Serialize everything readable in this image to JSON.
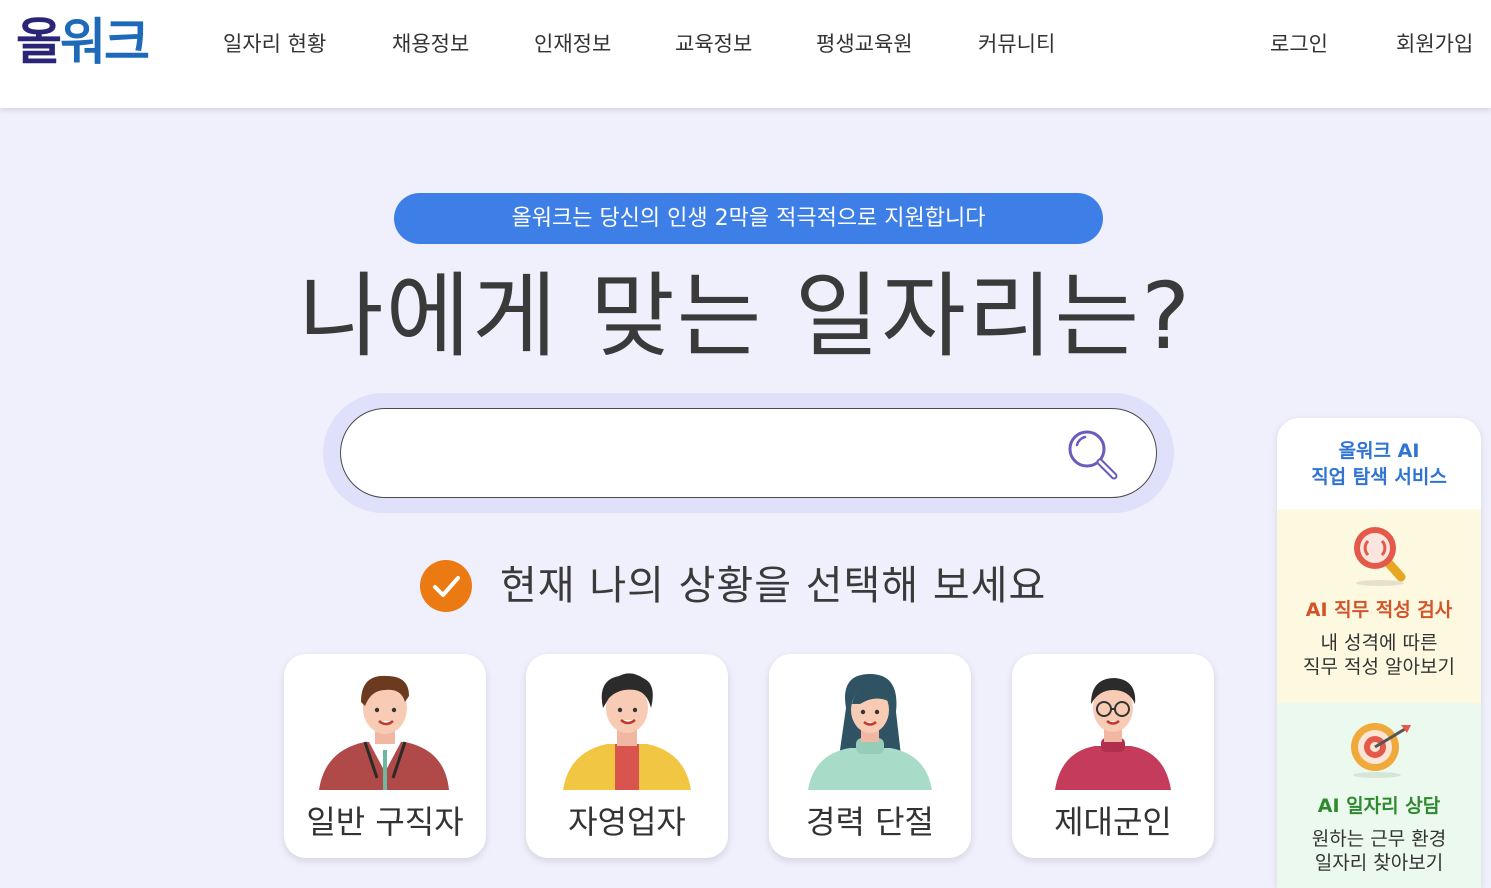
{
  "header": {
    "logo": {
      "part1": "올",
      "part2": "워크"
    },
    "nav": [
      "일자리 현황",
      "채용정보",
      "인재정보",
      "교육정보",
      "평생교육원",
      "커뮤니티"
    ],
    "login": "로그인",
    "signup": "회원가입"
  },
  "hero": {
    "pill": "올워크는 당신의 인생 2막을 적극적으로 지원합니다",
    "headline": "나에게 맞는 일자리는?",
    "search": {
      "placeholder": ""
    },
    "prompt": "현재 나의 상황을 선택해 보세요"
  },
  "cards": [
    {
      "label": "일반 구직자"
    },
    {
      "label": "자영업자"
    },
    {
      "label": "경력 단절"
    },
    {
      "label": "제대군인"
    }
  ],
  "side": {
    "title_line1": "올워크 AI",
    "title_line2": "직업 탐색 서비스",
    "aptitude": {
      "title": "AI 직무 적성 검사",
      "desc1": "내 성격에 따른",
      "desc2": "직무 적성 알아보기",
      "color": "#d4542a"
    },
    "counsel": {
      "title": "AI 일자리 상담",
      "desc1": "원하는 근무 환경",
      "desc2": "일자리 찾아보기",
      "color": "#2f8a2f"
    }
  },
  "colors": {
    "accent": "#3e7fe7",
    "check": "#ec7a12",
    "background": "#f0f0fd"
  }
}
